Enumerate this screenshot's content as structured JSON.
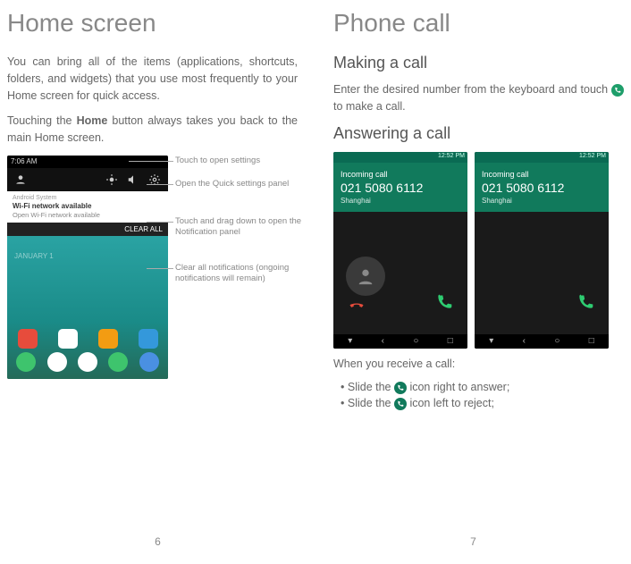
{
  "left": {
    "title": "Home screen",
    "intro": "You can bring all of the items (applications, shortcuts, folders, and widgets) that you use most frequently to your Home screen for quick access.",
    "para2_a": "Touching the ",
    "para2_b": "Home",
    "para2_c": " button always takes you back to the main Home screen.",
    "page_num": "6",
    "shot": {
      "time": "7:06 AM",
      "notif_title": "Wi-Fi network available",
      "notif_sub": "Open Wi-Fi network available",
      "clear_all": "CLEAR ALL",
      "date_big": "JANUARY 1"
    },
    "annot": {
      "settings": "Touch to open settings",
      "quick": "Open the Quick settings panel",
      "drag": "Touch and drag down to open the Notification panel",
      "clear": "Clear all notifications (ongoing notifications will remain)"
    }
  },
  "right": {
    "title": "Phone call",
    "h2_make": "Making a call",
    "make_a": "Enter the desired number from the keyboard and touch ",
    "make_b": " to make a call.",
    "h2_ans": "Answering a call",
    "call": {
      "label": "Incoming call",
      "number": "021 5080 6112",
      "location": "Shanghai",
      "status_time": "12:52 PM"
    },
    "receive_intro": "When you receive a call:",
    "bullet1_a": "Slide the ",
    "bullet1_b": " icon right to answer;",
    "bullet2_a": "Slide the ",
    "bullet2_b": " icon left to reject;",
    "page_num": "7"
  }
}
